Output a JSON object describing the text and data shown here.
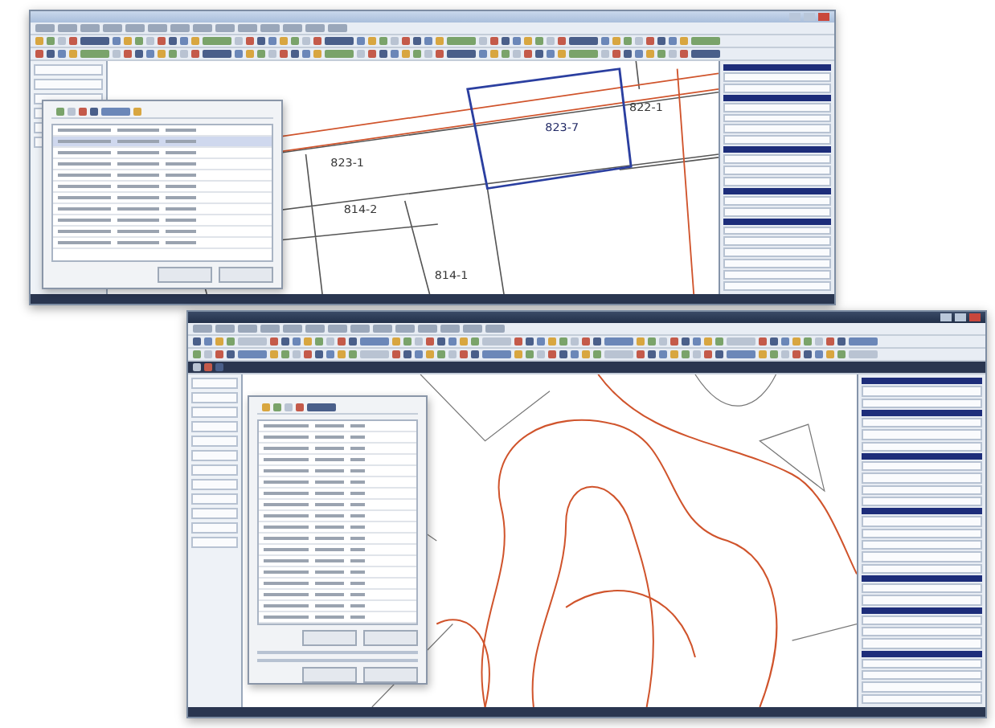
{
  "parcel_window": {
    "parcels": [
      {
        "label": "823-1",
        "selected": false
      },
      {
        "label": "823-7",
        "selected": true
      },
      {
        "label": "822-1",
        "selected": false
      },
      {
        "label": "814-2",
        "selected": false
      },
      {
        "label": "814-1",
        "selected": false
      }
    ]
  }
}
